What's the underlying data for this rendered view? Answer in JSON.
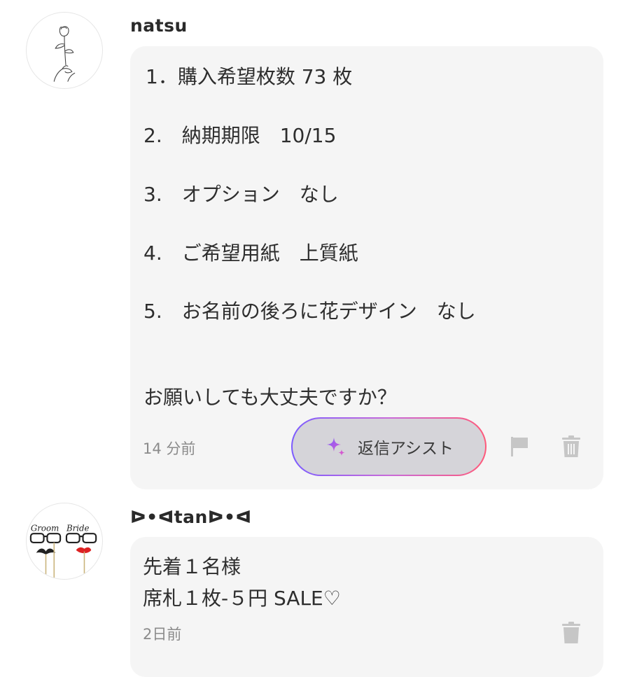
{
  "messages": [
    {
      "username": "natsu",
      "lines": [
        "1．購入希望枚数 73 枚",
        "2.　納期期限　10/15",
        "3.　オプション　なし",
        "4.　ご希望用紙　上質紙",
        "5.　お名前の後ろに花デザイン　なし",
        "お願いしても大丈夫ですか？"
      ],
      "time": "14 分前",
      "assist_label": "返信アシスト",
      "avatar_icon": "rose-hand-icon",
      "flag_icon": "flag-icon",
      "delete_icon": "trash-icon"
    },
    {
      "username": "ᐅ•ᐊtanᐅ•ᐊ",
      "lines": [
        "先着１名様",
        "席札１枚-５円 SALE♡"
      ],
      "time": "2日前",
      "avatar_icon": "groom-bride-props-icon",
      "delete_icon": "trash-icon"
    }
  ],
  "colors": {
    "bubble": "#f5f5f5",
    "assist_button": "#d5d4d9",
    "assist_gradient_start": "#7c5cff",
    "assist_gradient_end": "#ff5a7a",
    "muted_icon": "#c6c6c6"
  }
}
